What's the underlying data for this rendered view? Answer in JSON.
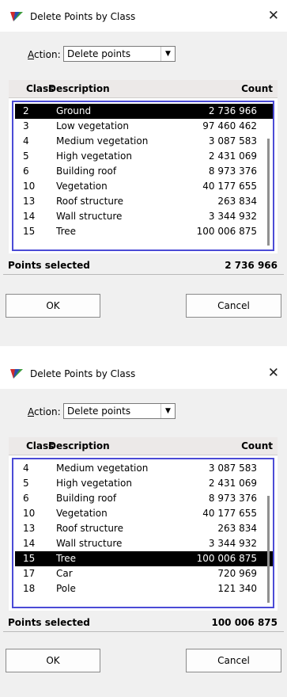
{
  "colors": {
    "selection": "#000000",
    "listbox_border": "#4b4bd6",
    "header_bg": "#ece9e8"
  },
  "dialogs": [
    {
      "title": "Delete Points by Class",
      "action_label": "Action:",
      "action_value": "Delete points",
      "headers": {
        "class": "Class",
        "description": "Description",
        "count": "Count"
      },
      "rows": [
        {
          "class": "2",
          "description": "Ground",
          "count": "2 736 966",
          "selected": true
        },
        {
          "class": "3",
          "description": "Low vegetation",
          "count": "97 460 462"
        },
        {
          "class": "4",
          "description": "Medium vegetation",
          "count": "3 087 583"
        },
        {
          "class": "5",
          "description": "High vegetation",
          "count": "2 431 069"
        },
        {
          "class": "6",
          "description": "Building roof",
          "count": "8 973 376"
        },
        {
          "class": "10",
          "description": "Vegetation",
          "count": "40 177 655"
        },
        {
          "class": "13",
          "description": "Roof structure",
          "count": "263 834"
        },
        {
          "class": "14",
          "description": "Wall structure",
          "count": "3 344 932"
        },
        {
          "class": "15",
          "description": "Tree",
          "count": "100 006 875"
        }
      ],
      "points_selected_label": "Points selected",
      "points_selected_value": "2 736 966",
      "ok_label": "OK",
      "cancel_label": "Cancel"
    },
    {
      "title": "Delete Points by Class",
      "action_label": "Action:",
      "action_value": "Delete points",
      "headers": {
        "class": "Class",
        "description": "Description",
        "count": "Count"
      },
      "rows": [
        {
          "class": "4",
          "description": "Medium vegetation",
          "count": "3 087 583"
        },
        {
          "class": "5",
          "description": "High vegetation",
          "count": "2 431 069"
        },
        {
          "class": "6",
          "description": "Building roof",
          "count": "8 973 376"
        },
        {
          "class": "10",
          "description": "Vegetation",
          "count": "40 177 655"
        },
        {
          "class": "13",
          "description": "Roof structure",
          "count": "263 834"
        },
        {
          "class": "14",
          "description": "Wall structure",
          "count": "3 344 932"
        },
        {
          "class": "15",
          "description": "Tree",
          "count": "100 006 875",
          "selected": true
        },
        {
          "class": "17",
          "description": "Car",
          "count": "720 969"
        },
        {
          "class": "18",
          "description": "Pole",
          "count": "121 340"
        }
      ],
      "points_selected_label": "Points selected",
      "points_selected_value": "100 006 875",
      "ok_label": "OK",
      "cancel_label": "Cancel"
    }
  ]
}
